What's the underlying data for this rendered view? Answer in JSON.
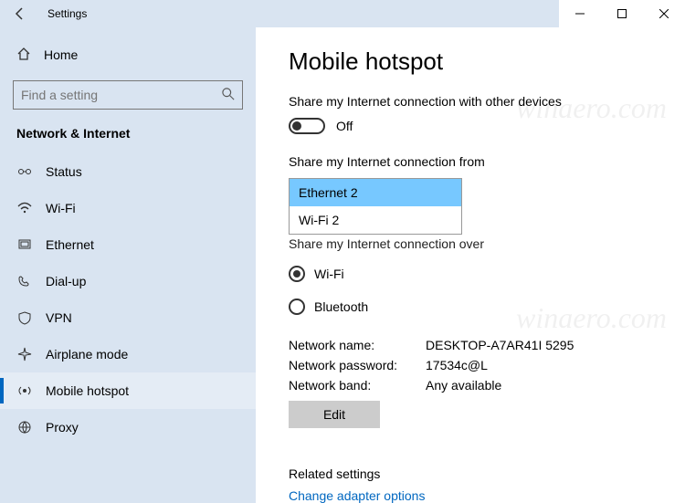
{
  "window": {
    "title": "Settings"
  },
  "sidebar": {
    "home": "Home",
    "search_placeholder": "Find a setting",
    "category": "Network & Internet",
    "items": [
      {
        "label": "Status"
      },
      {
        "label": "Wi-Fi"
      },
      {
        "label": "Ethernet"
      },
      {
        "label": "Dial-up"
      },
      {
        "label": "VPN"
      },
      {
        "label": "Airplane mode"
      },
      {
        "label": "Mobile hotspot"
      },
      {
        "label": "Proxy"
      }
    ]
  },
  "page": {
    "title": "Mobile hotspot",
    "share_toggle_label": "Share my Internet connection with other devices",
    "toggle_state": "Off",
    "share_from_label": "Share my Internet connection from",
    "share_from_options": [
      "Ethernet 2",
      "Wi-Fi 2"
    ],
    "share_over_label": "Share my Internet connection over",
    "radio_wifi": "Wi-Fi",
    "radio_bt": "Bluetooth",
    "props": {
      "name_label": "Network name:",
      "name_value": "DESKTOP-A7AR41I 5295",
      "pwd_label": "Network password:",
      "pwd_value": "17534c@L",
      "band_label": "Network band:",
      "band_value": "Any available"
    },
    "edit": "Edit",
    "related_h": "Related settings",
    "adapter_link": "Change adapter options"
  },
  "watermark": "winaero.com"
}
